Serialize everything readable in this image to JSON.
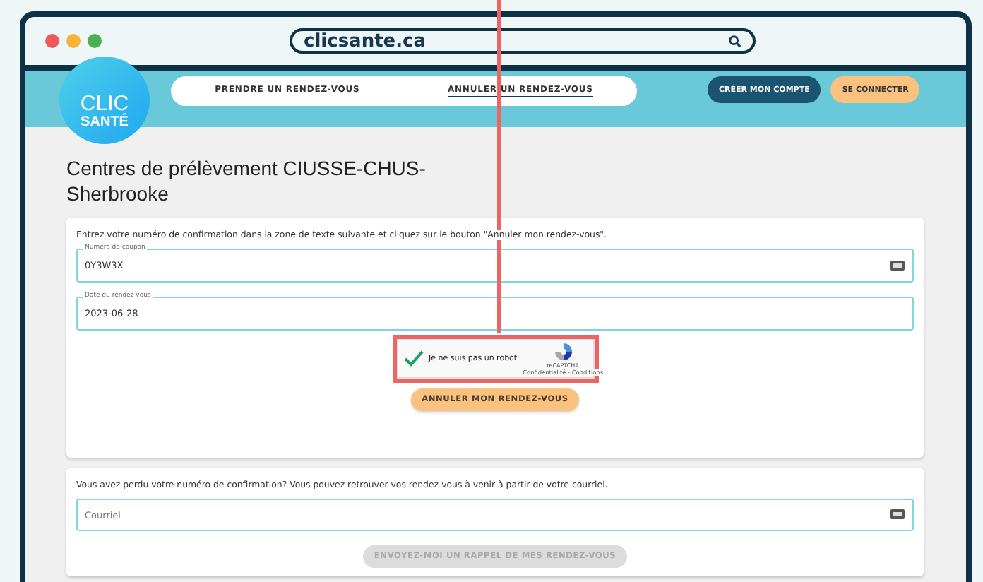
{
  "browser": {
    "address": "clicsante.ca"
  },
  "logo": {
    "line_1": "CLIC",
    "line_2": "SANTÉ"
  },
  "nav": {
    "links": [
      {
        "label": "PRENDRE UN RENDEZ-VOUS",
        "selected": false
      },
      {
        "label": "ANNULER UN RENDEZ-VOUS",
        "selected": true
      }
    ],
    "buttons": [
      {
        "label": "CRÉER MON COMPTE",
        "kind": "dark"
      },
      {
        "label": "SE CONNECTER",
        "kind": "light"
      }
    ]
  },
  "page_title": "Centres de prélèvement CIUSSE-CHUS-Sherbrooke",
  "cancel_card": {
    "instructions": "Entrez votre numéro de confirmation dans la zone de texte suivante et cliquez sur le bouton \"Annuler mon rendez-vous\".",
    "fields": [
      {
        "label": "Numéro de coupon",
        "value": "0Y3W3X",
        "kind": "ticket"
      },
      {
        "label": "Date du rendez-vous",
        "value": "2023-06-28",
        "kind": "plain"
      }
    ],
    "captcha": {
      "label": "Je ne suis pas un robot",
      "checked": true,
      "brand": "reCAPTCHA",
      "links": "Confidentialité - Conditions",
      "highlighted": true
    },
    "button": {
      "label": "ANNULER MON RENDEZ-VOUS",
      "disabled": false
    }
  },
  "reminder_card": {
    "instructions": "Vous avez perdu votre numéro de confirmation? Vous pouvez retrouver vos rendez-vous à venir à partir de votre courriel.",
    "field": {
      "placeholder": "Courriel"
    },
    "button": {
      "label": "ENVOYEZ-MOI UN RAPPEL DE MES RENDEZ-VOUS",
      "disabled": true
    }
  }
}
